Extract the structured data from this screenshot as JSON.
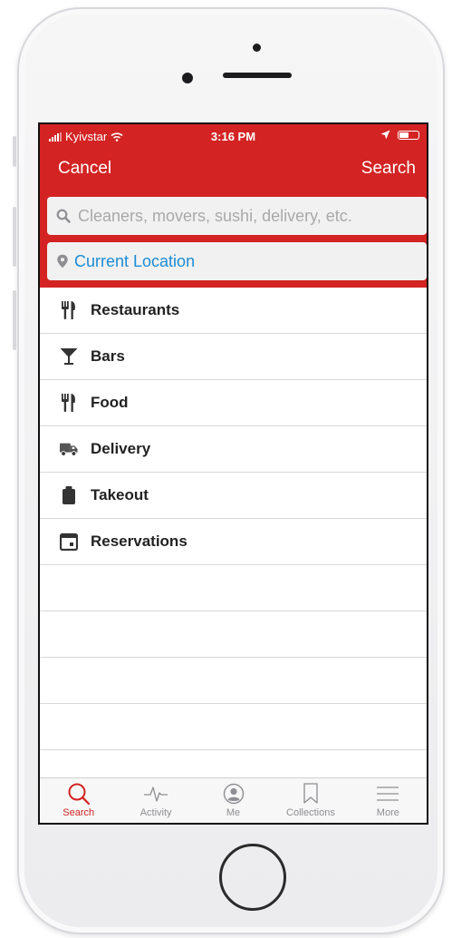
{
  "status_bar": {
    "carrier": "Kyivstar",
    "time": "3:16 PM"
  },
  "nav": {
    "cancel_label": "Cancel",
    "search_label": "Search"
  },
  "search": {
    "placeholder": "Cleaners, movers, sushi, delivery, etc."
  },
  "location": {
    "label": "Current Location"
  },
  "categories": [
    {
      "label": "Restaurants",
      "icon": "fork-knife-icon"
    },
    {
      "label": "Bars",
      "icon": "cocktail-icon"
    },
    {
      "label": "Food",
      "icon": "fork-knife-icon"
    },
    {
      "label": "Delivery",
      "icon": "truck-icon"
    },
    {
      "label": "Takeout",
      "icon": "takeout-bag-icon"
    },
    {
      "label": "Reservations",
      "icon": "calendar-icon"
    }
  ],
  "tabs": [
    {
      "label": "Search",
      "icon": "search-icon",
      "active": true
    },
    {
      "label": "Activity",
      "icon": "activity-icon",
      "active": false
    },
    {
      "label": "Me",
      "icon": "profile-icon",
      "active": false
    },
    {
      "label": "Collections",
      "icon": "bookmark-icon",
      "active": false
    },
    {
      "label": "More",
      "icon": "menu-icon",
      "active": false
    }
  ],
  "colors": {
    "brand_red": "#d32323",
    "link_blue": "#1b8cd6"
  }
}
